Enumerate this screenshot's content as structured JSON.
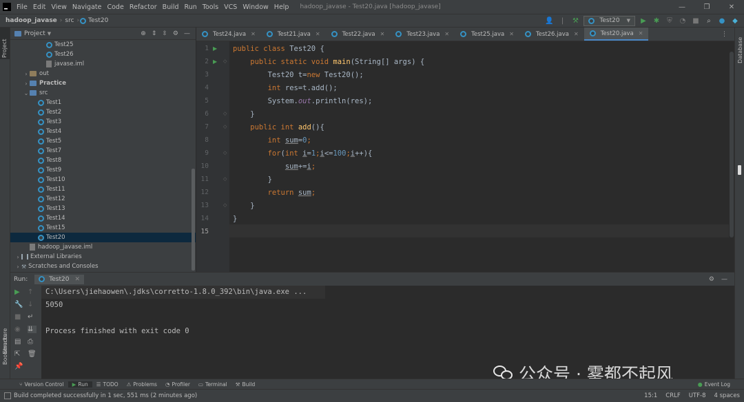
{
  "menu": {
    "items": [
      "File",
      "Edit",
      "View",
      "Navigate",
      "Code",
      "Refactor",
      "Build",
      "Run",
      "Tools",
      "VCS",
      "Window",
      "Help"
    ],
    "window_title": "hadoop_javase - Test20.java [hadoop_javase]"
  },
  "nav": {
    "project": "hadoop_javase",
    "folder": "src",
    "file": "Test20",
    "run_config": "Test20"
  },
  "left_strip": {
    "project": "Project",
    "structure": "Structure",
    "bookmarks": "Bookmarks"
  },
  "right_strip": {
    "database": "Database"
  },
  "project_panel": {
    "title": "Project",
    "rows": [
      {
        "label": "Test25",
        "type": "class",
        "indent": 3
      },
      {
        "label": "Test26",
        "type": "class",
        "indent": 3
      },
      {
        "label": "javase.iml",
        "type": "file",
        "indent": 3
      },
      {
        "label": "out",
        "type": "folder",
        "indent": 1,
        "arrow": "›"
      },
      {
        "label": "Practice",
        "type": "module",
        "indent": 1,
        "arrow": "›"
      },
      {
        "label": "src",
        "type": "srcfolder",
        "indent": 1,
        "arrow": "⌄"
      },
      {
        "label": "Test1",
        "type": "class",
        "indent": 2
      },
      {
        "label": "Test2",
        "type": "class",
        "indent": 2
      },
      {
        "label": "Test3",
        "type": "class",
        "indent": 2
      },
      {
        "label": "Test4",
        "type": "class",
        "indent": 2
      },
      {
        "label": "Test5",
        "type": "class",
        "indent": 2
      },
      {
        "label": "Test7",
        "type": "class",
        "indent": 2
      },
      {
        "label": "Test8",
        "type": "class",
        "indent": 2
      },
      {
        "label": "Test9",
        "type": "class",
        "indent": 2
      },
      {
        "label": "Test10",
        "type": "class",
        "indent": 2
      },
      {
        "label": "Test11",
        "type": "class",
        "indent": 2
      },
      {
        "label": "Test12",
        "type": "class",
        "indent": 2
      },
      {
        "label": "Test13",
        "type": "class",
        "indent": 2
      },
      {
        "label": "Test14",
        "type": "class",
        "indent": 2
      },
      {
        "label": "Test15",
        "type": "class",
        "indent": 2
      },
      {
        "label": "Test20",
        "type": "class",
        "indent": 2,
        "selected": true
      },
      {
        "label": "hadoop_javase.iml",
        "type": "file",
        "indent": 1
      },
      {
        "label": "External Libraries",
        "type": "lib",
        "indent": 0,
        "arrow": "›"
      },
      {
        "label": "Scratches and Consoles",
        "type": "scratch",
        "indent": 0,
        "arrow": "›"
      }
    ]
  },
  "tabs": [
    {
      "label": "Test24.java",
      "active": false
    },
    {
      "label": "Test21.java",
      "active": false
    },
    {
      "label": "Test22.java",
      "active": false
    },
    {
      "label": "Test23.java",
      "active": false
    },
    {
      "label": "Test25.java",
      "active": false
    },
    {
      "label": "Test26.java",
      "active": false
    },
    {
      "label": "Test20.java",
      "active": true
    }
  ],
  "code": {
    "line_numbers": [
      "1",
      "2",
      "3",
      "4",
      "5",
      "6",
      "7",
      "8",
      "9",
      "10",
      "11",
      "12",
      "13",
      "14",
      "15"
    ],
    "lines": [
      [
        {
          "t": "public class ",
          "c": "kw"
        },
        {
          "t": "Test20 {",
          "c": ""
        }
      ],
      [
        {
          "t": "    public static void ",
          "c": "kw"
        },
        {
          "t": "main",
          "c": "fn"
        },
        {
          "t": "(String[] args) {",
          "c": ""
        }
      ],
      [
        {
          "t": "        Test20 t=",
          "c": ""
        },
        {
          "t": "new ",
          "c": "kw"
        },
        {
          "t": "Test20();",
          "c": ""
        }
      ],
      [
        {
          "t": "        ",
          "c": ""
        },
        {
          "t": "int ",
          "c": "kw"
        },
        {
          "t": "res=t.add();",
          "c": ""
        }
      ],
      [
        {
          "t": "        System.",
          "c": ""
        },
        {
          "t": "out",
          "c": "st"
        },
        {
          "t": ".println(res);",
          "c": ""
        }
      ],
      [
        {
          "t": "    }",
          "c": ""
        }
      ],
      [
        {
          "t": "    public int ",
          "c": "kw"
        },
        {
          "t": "add",
          "c": "fn"
        },
        {
          "t": "(){",
          "c": ""
        }
      ],
      [
        {
          "t": "        ",
          "c": ""
        },
        {
          "t": "int ",
          "c": "kw"
        },
        {
          "t": "sum",
          "c": "ul"
        },
        {
          "t": "=",
          "c": ""
        },
        {
          "t": "0",
          "c": "num"
        },
        {
          "t": ";",
          "c": "kw"
        }
      ],
      [
        {
          "t": "        ",
          "c": ""
        },
        {
          "t": "for",
          "c": "kw"
        },
        {
          "t": "(",
          "c": ""
        },
        {
          "t": "int ",
          "c": "kw"
        },
        {
          "t": "i",
          "c": "ul"
        },
        {
          "t": "=",
          "c": ""
        },
        {
          "t": "1",
          "c": "num"
        },
        {
          "t": ";",
          "c": "kw"
        },
        {
          "t": "i",
          "c": "ul"
        },
        {
          "t": "<=",
          "c": ""
        },
        {
          "t": "100",
          "c": "num"
        },
        {
          "t": ";",
          "c": "kw"
        },
        {
          "t": "i",
          "c": "ul"
        },
        {
          "t": "++){",
          "c": ""
        }
      ],
      [
        {
          "t": "            ",
          "c": ""
        },
        {
          "t": "sum",
          "c": "ul"
        },
        {
          "t": "+=",
          "c": ""
        },
        {
          "t": "i",
          "c": "ul"
        },
        {
          "t": ";",
          "c": "kw"
        }
      ],
      [
        {
          "t": "        }",
          "c": ""
        }
      ],
      [
        {
          "t": "        ",
          "c": ""
        },
        {
          "t": "return ",
          "c": "kw"
        },
        {
          "t": "sum",
          "c": "ul"
        },
        {
          "t": ";",
          "c": "kw"
        }
      ],
      [
        {
          "t": "    }",
          "c": ""
        }
      ],
      [
        {
          "t": "}",
          "c": ""
        }
      ],
      []
    ]
  },
  "run": {
    "label": "Run:",
    "tab": "Test20",
    "console": [
      "C:\\Users\\jiehaowen\\.jdks\\corretto-1.8.0_392\\bin\\java.exe ...",
      "5050",
      "",
      "Process finished with exit code 0"
    ]
  },
  "bottom_tools": [
    {
      "label": "Version Control",
      "icon": "branch-icon"
    },
    {
      "label": "Run",
      "icon": "play-icon",
      "active": true
    },
    {
      "label": "TODO",
      "icon": "list-icon"
    },
    {
      "label": "Problems",
      "icon": "warning-icon"
    },
    {
      "label": "Profiler",
      "icon": "gauge-icon"
    },
    {
      "label": "Terminal",
      "icon": "terminal-icon"
    },
    {
      "label": "Build",
      "icon": "hammer-icon"
    }
  ],
  "event_log": "Event Log",
  "status": {
    "message": "Build completed successfully in 1 sec, 551 ms (2 minutes ago)",
    "position": "15:1",
    "line_sep": "CRLF",
    "encoding": "UTF-8",
    "indent": "4 spaces"
  },
  "watermark": {
    "text": "公众号 · 雾都不起风"
  },
  "colors": {
    "keyword": "#cc7832",
    "function": "#ffc66d",
    "number": "#6897bb",
    "static_field": "#9876aa",
    "run_green": "#499c54",
    "class_icon": "#3592c4"
  }
}
